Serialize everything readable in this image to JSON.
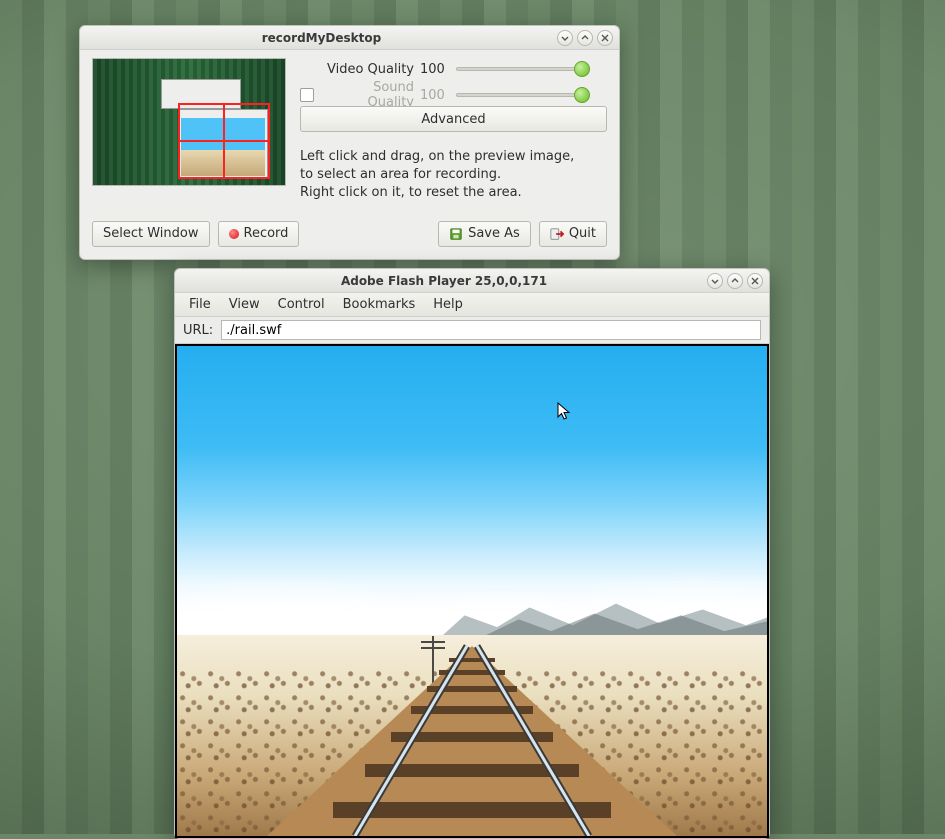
{
  "rmd": {
    "title": "recordMyDesktop",
    "video_quality_label": "Video Quality",
    "video_quality_value": "100",
    "sound_quality_label": "Sound Quality",
    "sound_quality_value": "100",
    "sound_checked": false,
    "advanced_label": "Advanced",
    "instructions_line1": "Left click and drag, on the preview image,",
    "instructions_line2": "to select an area for recording.",
    "instructions_line3": "Right click on it, to reset the area.",
    "select_window_label": "Select Window",
    "record_label": "Record",
    "save_as_label": "Save As",
    "quit_label": "Quit"
  },
  "flash": {
    "title": "Adobe Flash Player 25,0,0,171",
    "menus": [
      "File",
      "View",
      "Control",
      "Bookmarks",
      "Help"
    ],
    "url_label": "URL:",
    "url_value": "./rail.swf"
  }
}
